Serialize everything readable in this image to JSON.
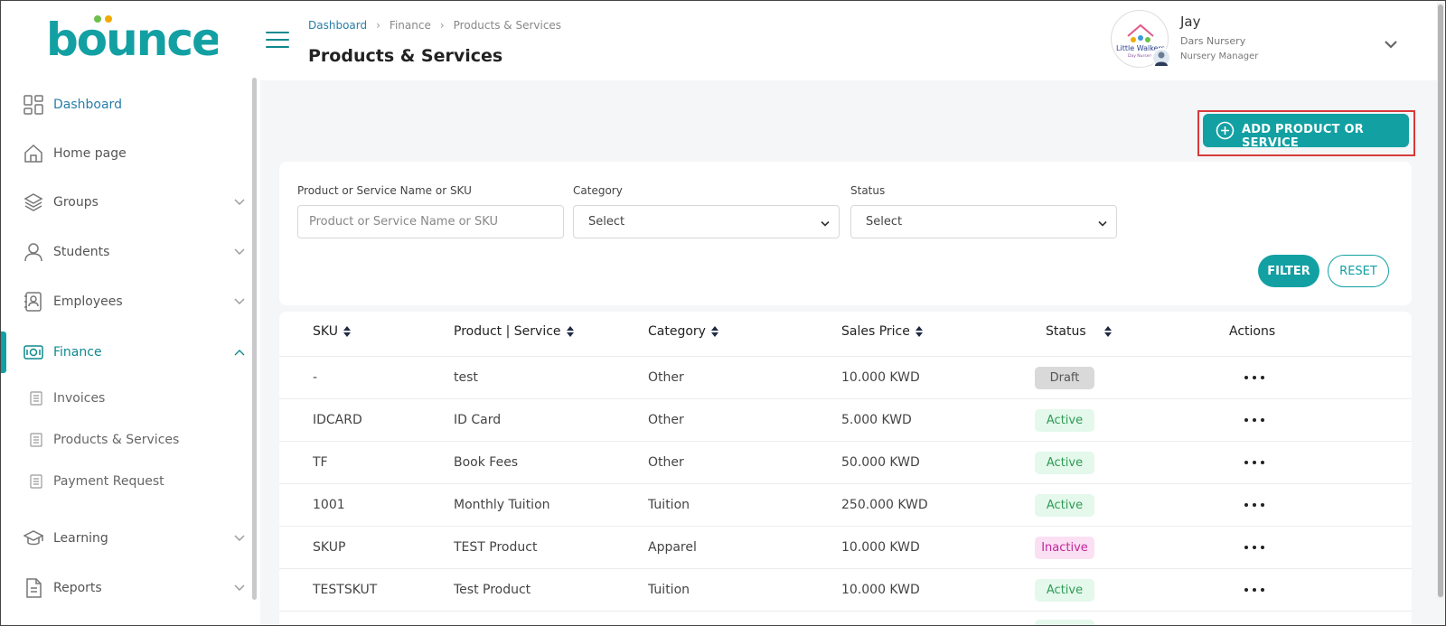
{
  "app": {
    "logo_text": "bounce",
    "brand_color": "#12a0a3",
    "accent_dark": "#0e8a8f"
  },
  "sidebar": {
    "items": [
      {
        "label": "Dashboard",
        "icon": "dashboard-icon",
        "active_style": true
      },
      {
        "label": "Home page",
        "icon": "home-icon"
      },
      {
        "label": "Groups",
        "icon": "layers-icon",
        "expandable": true
      },
      {
        "label": "Students",
        "icon": "user-icon",
        "expandable": true
      },
      {
        "label": "Employees",
        "icon": "contacts-book-icon",
        "expandable": true
      },
      {
        "label": "Finance",
        "icon": "money-icon",
        "expandable": true,
        "expanded": true,
        "selected": true
      },
      {
        "label": "Learning",
        "icon": "graduation-cap-icon",
        "expandable": true
      },
      {
        "label": "Reports",
        "icon": "report-icon",
        "expandable": true
      }
    ],
    "finance_sub": [
      {
        "label": "Invoices",
        "icon": "document-icon"
      },
      {
        "label": "Products & Services",
        "icon": "document-icon"
      },
      {
        "label": "Payment Request",
        "icon": "document-icon"
      }
    ]
  },
  "header": {
    "breadcrumb": [
      "Dashboard",
      "Finance",
      "Products & Services"
    ],
    "title": "Products & Services",
    "user": {
      "name": "Jay",
      "org": "Dars Nursery",
      "role": "Nursery Manager",
      "avatar_text": "Little Walkers",
      "avatar_subtext": "Day Nursery"
    }
  },
  "actions": {
    "add_label": "ADD PRODUCT OR SERVICE"
  },
  "filters": {
    "name": {
      "label": "Product or Service Name or SKU",
      "placeholder": "Product or Service Name or SKU",
      "value": ""
    },
    "category": {
      "label": "Category",
      "value": "Select"
    },
    "status": {
      "label": "Status",
      "value": "Select"
    },
    "filter_label": "FILTER",
    "reset_label": "RESET"
  },
  "table": {
    "columns": [
      "SKU",
      "Product | Service",
      "Category",
      "Sales Price",
      "Status",
      "Actions"
    ],
    "rows": [
      {
        "sku": "-",
        "name": "test",
        "category": "Other",
        "price": "10.000 KWD",
        "status": "Draft"
      },
      {
        "sku": "IDCARD",
        "name": "ID Card",
        "category": "Other",
        "price": "5.000 KWD",
        "status": "Active"
      },
      {
        "sku": "TF",
        "name": "Book Fees",
        "category": "Other",
        "price": "50.000 KWD",
        "status": "Active"
      },
      {
        "sku": "1001",
        "name": "Monthly Tuition",
        "category": "Tuition",
        "price": "250.000 KWD",
        "status": "Active"
      },
      {
        "sku": "SKUP",
        "name": "TEST Product",
        "category": "Apparel",
        "price": "10.000 KWD",
        "status": "Inactive"
      },
      {
        "sku": "TESTSKUT",
        "name": "Test Product",
        "category": "Tuition",
        "price": "10.000 KWD",
        "status": "Active"
      }
    ]
  },
  "status_colors": {
    "draft": "#d9d9d9",
    "active": "#2f9b54",
    "inactive": "#c0269a"
  }
}
